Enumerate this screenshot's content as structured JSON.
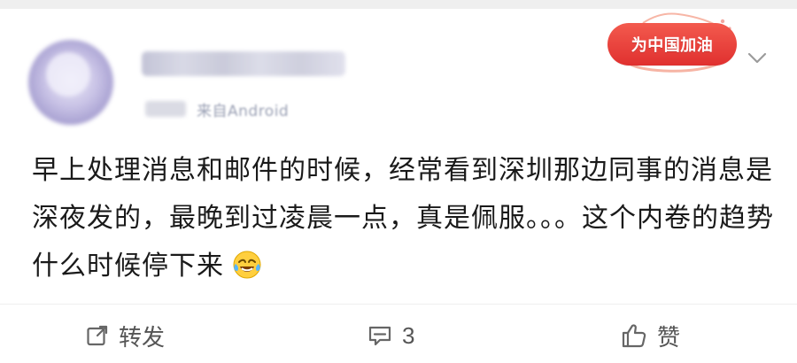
{
  "post": {
    "username_text": "",
    "meta_date": "9-3",
    "meta_from": "来自Android",
    "badge_text": "为中国加油",
    "content": "早上处理消息和邮件的时候，经常看到深圳那边同事的消息是深夜发的，最晚到过凌晨一点，真是佩服。。。这个内卷的趋势什么时候停下来",
    "emoji_name": "crying-laughing-face"
  },
  "actions": {
    "repost_label": "转发",
    "comment_count": "3",
    "like_label": "赞"
  },
  "colors": {
    "badge_red": "#e0302f",
    "text": "#1a1a1a",
    "action_gray": "#555555"
  }
}
